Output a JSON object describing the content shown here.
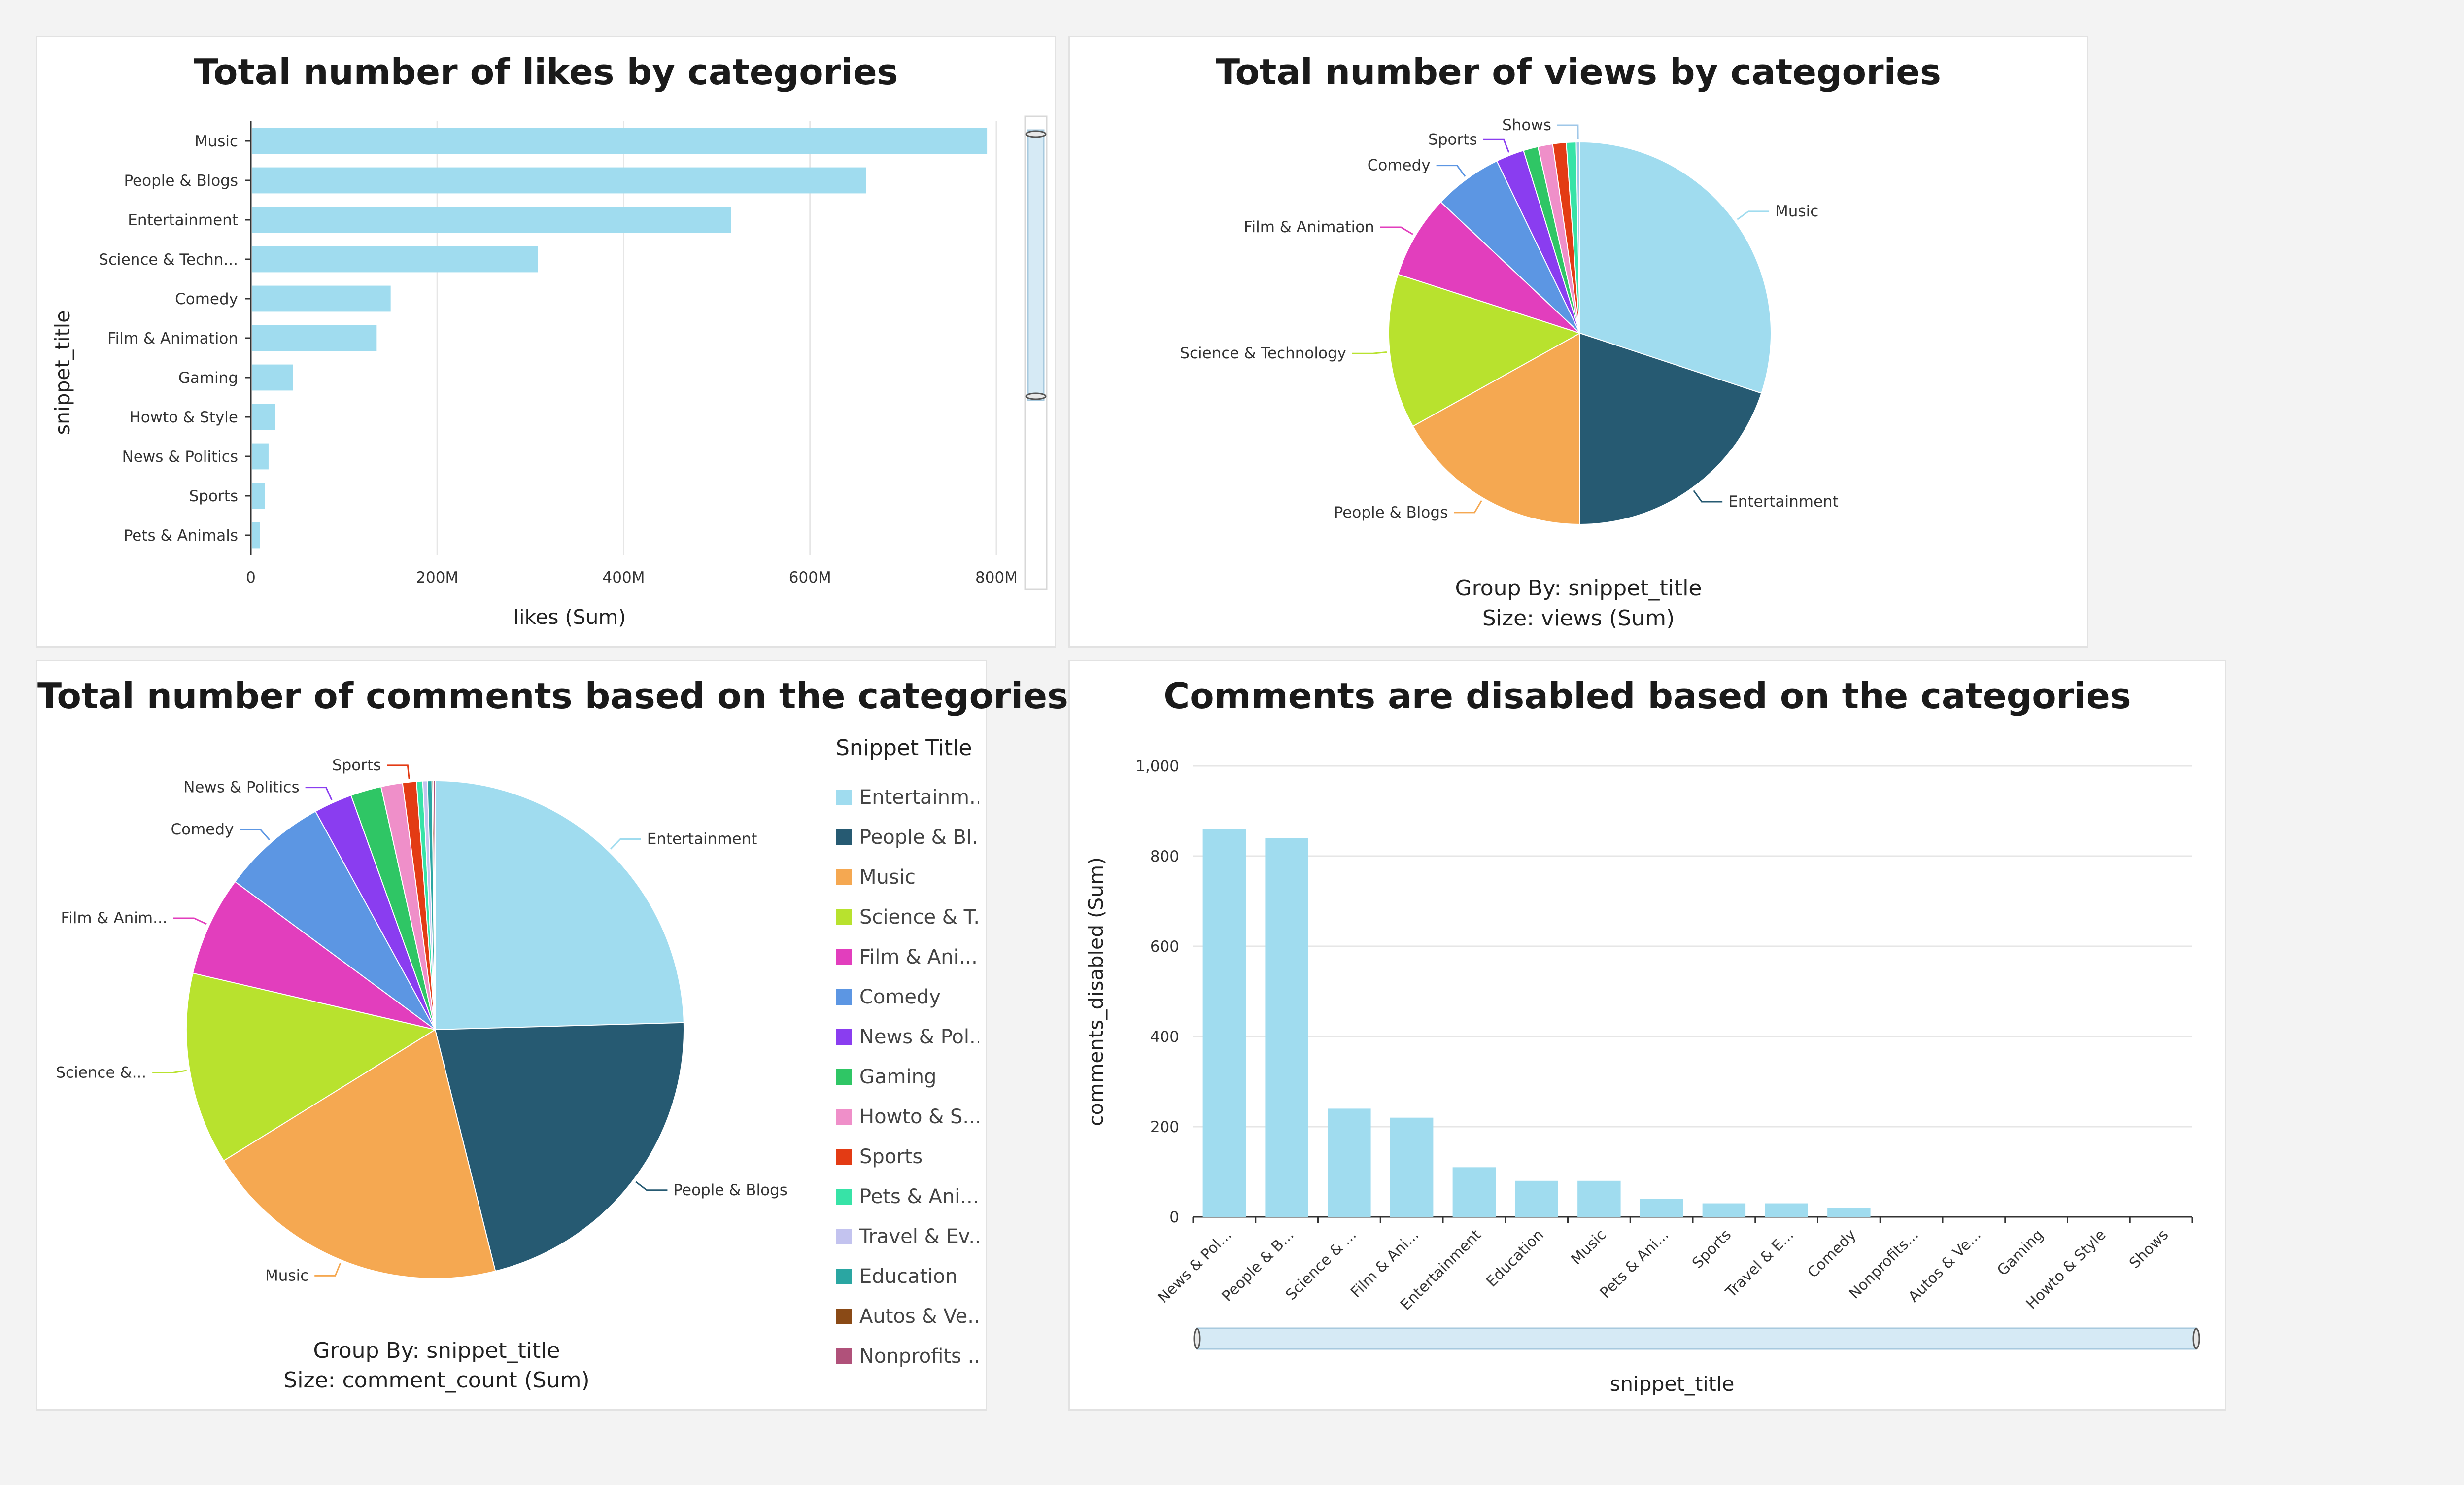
{
  "colors": {
    "bar": "#a0dcef",
    "grid": "#e6e6e6",
    "axis": "#333333",
    "text": "#333333",
    "scroll": "#d6eaf5",
    "scroll_border": "#a7c9de"
  },
  "panels": {
    "likes": {
      "title": "Total number of likes by categories"
    },
    "views": {
      "title": "Total number of views by categories",
      "group_by": "Group By: snippet_title",
      "size": "Size: views (Sum)"
    },
    "comments": {
      "title": "Total number of comments based on the categories",
      "group_by": "Group By: snippet_title",
      "size": "Size: comment_count (Sum)",
      "legend_title": "Snippet Title",
      "legend": [
        {
          "label": "Entertainm...",
          "color": "#a0dcef"
        },
        {
          "label": "People & Bl...",
          "color": "#265a72"
        },
        {
          "label": "Music",
          "color": "#f5a851"
        },
        {
          "label": "Science & T...",
          "color": "#b8e22e"
        },
        {
          "label": "Film & Ani...",
          "color": "#e23ebd"
        },
        {
          "label": "Comedy",
          "color": "#5c96e3"
        },
        {
          "label": "News & Pol...",
          "color": "#8a3df0"
        },
        {
          "label": "Gaming",
          "color": "#2fc665"
        },
        {
          "label": "Howto & S...",
          "color": "#ef8fc9"
        },
        {
          "label": "Sports",
          "color": "#e33b14"
        },
        {
          "label": "Pets & Ani...",
          "color": "#37e3a7"
        },
        {
          "label": "Travel & Ev...",
          "color": "#c3c3ef"
        },
        {
          "label": "Education",
          "color": "#2aa6a2"
        },
        {
          "label": "Autos & Ve...",
          "color": "#8a4a16"
        },
        {
          "label": "Nonprofits ...",
          "color": "#b0517a"
        }
      ]
    },
    "disabled": {
      "title": "Comments are disabled based on the categories"
    }
  },
  "chart_data": [
    {
      "type": "bar",
      "orientation": "horizontal",
      "title": "Total number of likes by categories",
      "xlabel": "likes (Sum)",
      "ylabel": "snippet_title",
      "categories": [
        "Music",
        "People & Blogs",
        "Entertainment",
        "Science & Techn...",
        "Comedy",
        "Film & Animation",
        "Gaming",
        "Howto & Style",
        "News & Politics",
        "Sports",
        "Pets & Animals"
      ],
      "values": [
        790000000,
        660000000,
        515000000,
        308000000,
        150000000,
        135000000,
        45000000,
        26000000,
        19000000,
        15000000,
        10000000
      ],
      "xlim": [
        0,
        800000000
      ],
      "xticks": [
        {
          "v": 0,
          "label": "0"
        },
        {
          "v": 200000000,
          "label": "200M"
        },
        {
          "v": 400000000,
          "label": "400M"
        },
        {
          "v": 600000000,
          "label": "600M"
        },
        {
          "v": 800000000,
          "label": "800M"
        }
      ]
    },
    {
      "type": "pie",
      "title": "Total number of views by categories",
      "slices": [
        {
          "label": "Music",
          "value": 29.0,
          "color": "#a0dcef"
        },
        {
          "label": "Entertainment",
          "value": 19.2,
          "color": "#265a72"
        },
        {
          "label": "People & Blogs",
          "value": 16.3,
          "color": "#f5a851"
        },
        {
          "label": "Science & Technology",
          "value": 12.6,
          "color": "#b8e22e"
        },
        {
          "label": "Film & Animation",
          "value": 6.8,
          "color": "#e23ebd"
        },
        {
          "label": "Comedy",
          "value": 5.6,
          "color": "#5c96e3"
        },
        {
          "label": "Sports",
          "value": 2.3,
          "color": "#8a3df0"
        },
        {
          "label": "",
          "value": 1.2,
          "color": "#2fc665"
        },
        {
          "label": "",
          "value": 1.2,
          "color": "#ef8fc9"
        },
        {
          "label": "",
          "value": 1.1,
          "color": "#e33b14"
        },
        {
          "label": "",
          "value": 0.8,
          "color": "#37e3a7"
        },
        {
          "label": "Shows",
          "value": 0.3,
          "color": "#9fc7e8"
        }
      ]
    },
    {
      "type": "pie",
      "title": "Total number of comments based on the categories",
      "slices": [
        {
          "label": "Entertainment",
          "value": 24.6,
          "color": "#a0dcef"
        },
        {
          "label": "People & Blogs",
          "value": 21.6,
          "color": "#265a72"
        },
        {
          "label": "Music",
          "value": 20.1,
          "color": "#f5a851"
        },
        {
          "label": "Science &...",
          "value": 12.5,
          "color": "#b8e22e"
        },
        {
          "label": "Film & Anim...",
          "value": 6.5,
          "color": "#e23ebd"
        },
        {
          "label": "Comedy",
          "value": 6.9,
          "color": "#5c96e3"
        },
        {
          "label": "News & Politics",
          "value": 2.5,
          "color": "#8a3df0"
        },
        {
          "label": "",
          "value": 2.0,
          "color": "#2fc665"
        },
        {
          "label": "",
          "value": 1.4,
          "color": "#ef8fc9"
        },
        {
          "label": "Sports",
          "value": 0.9,
          "color": "#e33b14"
        },
        {
          "label": "",
          "value": 0.4,
          "color": "#37e3a7"
        },
        {
          "label": "",
          "value": 0.3,
          "color": "#c3c3ef"
        },
        {
          "label": "",
          "value": 0.3,
          "color": "#2aa6a2"
        },
        {
          "label": "",
          "value": 0.1,
          "color": "#8a4a16"
        },
        {
          "label": "",
          "value": 0.1,
          "color": "#b0517a"
        }
      ]
    },
    {
      "type": "bar",
      "orientation": "vertical",
      "title": "Comments are disabled based on the categories",
      "xlabel": "snippet_title",
      "ylabel": "comments_disabled (Sum)",
      "categories": [
        "News & Pol...",
        "People & B...",
        "Science & ...",
        "Film & Ani...",
        "Entertainment",
        "Education",
        "Music",
        "Pets & Ani...",
        "Sports",
        "Travel & E...",
        "Comedy",
        "Nonprofits...",
        "Autos & Ve...",
        "Gaming",
        "Howto & Style",
        "Shows"
      ],
      "values": [
        860,
        840,
        240,
        220,
        110,
        80,
        80,
        40,
        30,
        30,
        20,
        0,
        0,
        0,
        0,
        0
      ],
      "ylim": [
        0,
        1000
      ],
      "yticks": [
        {
          "v": 0,
          "label": "0"
        },
        {
          "v": 200,
          "label": "200"
        },
        {
          "v": 400,
          "label": "400"
        },
        {
          "v": 600,
          "label": "600"
        },
        {
          "v": 800,
          "label": "800"
        },
        {
          "v": 1000,
          "label": "1,000"
        }
      ]
    }
  ]
}
